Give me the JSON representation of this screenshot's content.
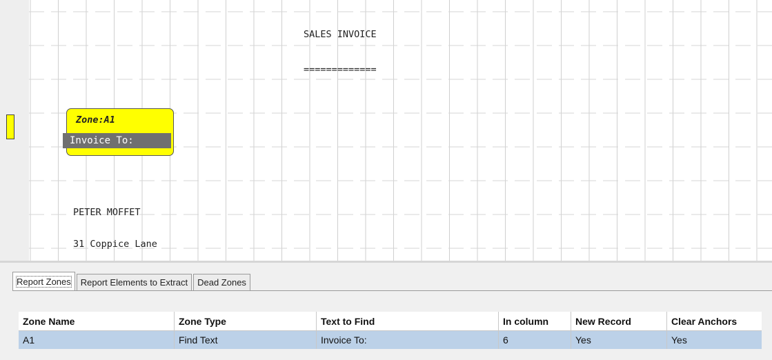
{
  "preview": {
    "lines": {
      "title": "SALES INVOICE",
      "underline": "=============",
      "name": "PETER MOFFET",
      "address": "31 Coppice Lane"
    },
    "zone_box": {
      "title": "Zone:A1",
      "text": "Invoice To:",
      "color": "#ffff00"
    }
  },
  "tabs": [
    {
      "label": "Report Zones",
      "active": true
    },
    {
      "label": "Report Elements to Extract",
      "active": false
    },
    {
      "label": "Dead Zones",
      "active": false
    }
  ],
  "table": {
    "columns": [
      "Zone Name",
      "Zone Type",
      "Text to Find",
      "In column",
      "New Record",
      "Clear Anchors"
    ],
    "rows": [
      [
        "A1",
        "Find Text",
        "Invoice To:",
        "6",
        "Yes",
        "Yes"
      ]
    ],
    "selected_row_color": "#bcd1e8"
  }
}
